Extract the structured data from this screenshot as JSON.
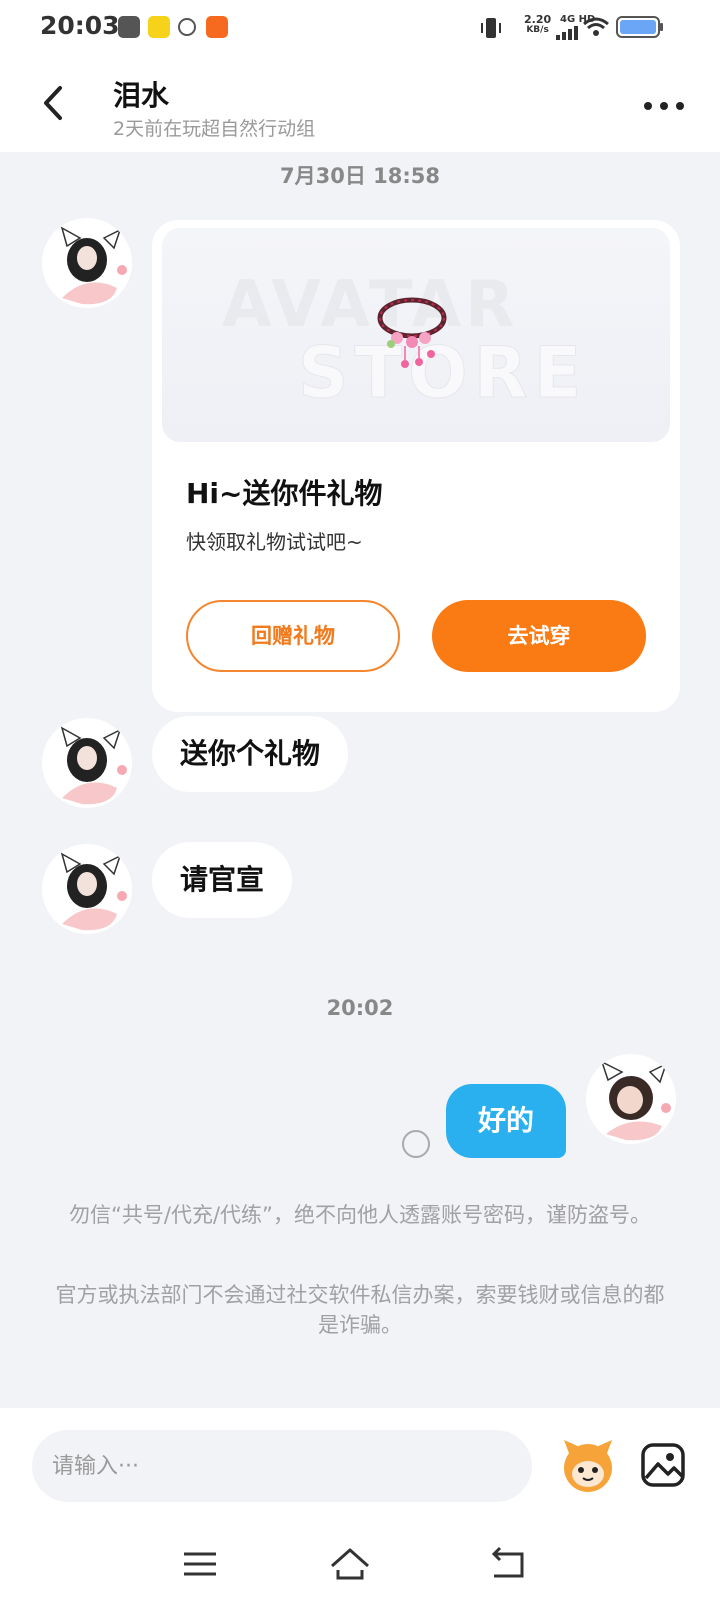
{
  "status_bar": {
    "time": "20:03",
    "speed_value": "2.20",
    "speed_unit": "KB/s",
    "network": "4G HD"
  },
  "header": {
    "name": "泪水",
    "status": "2天前在玩超自然行动组"
  },
  "messages": {
    "timestamp1": "7月30日 18:58",
    "gift_card": {
      "banner_text_1": "AVATAR",
      "banner_text_2": "STORE",
      "title": "Hi~送你件礼物",
      "subtitle": "快领取礼物试试吧~",
      "return_label": "回赠礼物",
      "try_label": "去试穿"
    },
    "msg1": "送你个礼物",
    "msg2": "请官宣",
    "timestamp2": "20:02",
    "reply": "好的"
  },
  "notices": {
    "line1": "勿信“共号/代充/代练”，绝不向他人透露账号密码，谨防盗号。",
    "line2": "官方或执法部门不会通过社交软件私信办案，索要钱财或信息的都是诈骗。"
  },
  "input": {
    "placeholder": "请输入···"
  },
  "colors": {
    "accent_orange": "#fa7a14",
    "bubble_blue": "#2ab0ef"
  }
}
